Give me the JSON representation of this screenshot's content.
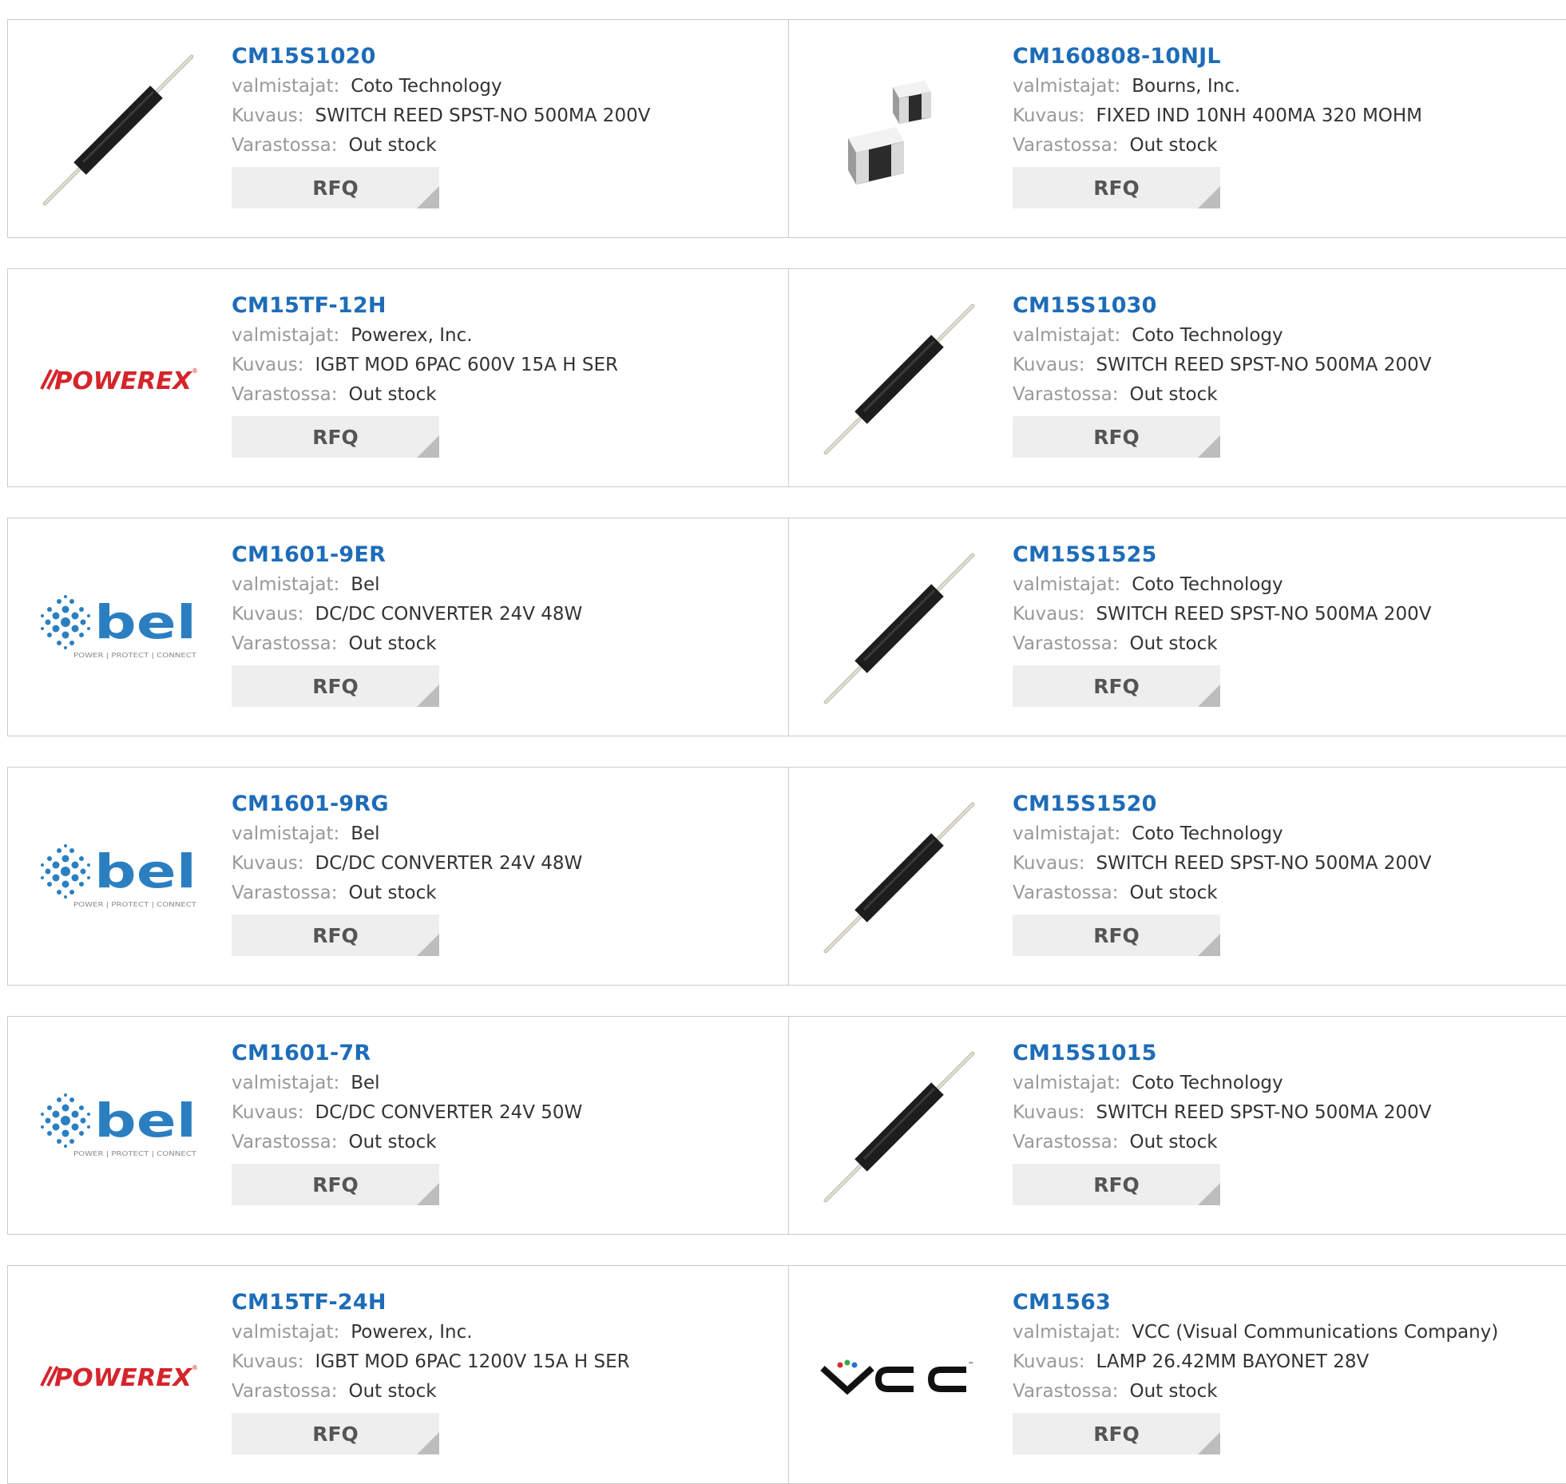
{
  "labels": {
    "manufacturer": "valmistajat:",
    "description": "Kuvaus:",
    "stock": "Varastossa:",
    "rfq": "RFQ"
  },
  "colors": {
    "link": "#1e6cb8",
    "label": "#999999",
    "value": "#333333",
    "border": "#cccccc",
    "button_bg": "#eeeeee"
  },
  "products": [
    {
      "part": "CM15S1020",
      "manufacturer": "Coto Technology",
      "description": "SWITCH REED SPST-NO 500MA 200V",
      "stock": "Out stock",
      "image": "reed-switch-image"
    },
    {
      "part": "CM160808-10NJL",
      "manufacturer": "Bourns, Inc.",
      "description": "FIXED IND 10NH 400MA 320 MOHM",
      "stock": "Out stock",
      "image": "chip-inductor-image"
    },
    {
      "part": "CM15TF-12H",
      "manufacturer": "Powerex, Inc.",
      "description": "IGBT MOD 6PAC 600V 15A H SER",
      "stock": "Out stock",
      "image": "powerex-logo"
    },
    {
      "part": "CM15S1030",
      "manufacturer": "Coto Technology",
      "description": "SWITCH REED SPST-NO 500MA 200V",
      "stock": "Out stock",
      "image": "reed-switch-image"
    },
    {
      "part": "CM1601-9ER",
      "manufacturer": "Bel",
      "description": "DC/DC CONVERTER 24V 48W",
      "stock": "Out stock",
      "image": "bel-logo"
    },
    {
      "part": "CM15S1525",
      "manufacturer": "Coto Technology",
      "description": "SWITCH REED SPST-NO 500MA 200V",
      "stock": "Out stock",
      "image": "reed-switch-image"
    },
    {
      "part": "CM1601-9RG",
      "manufacturer": "Bel",
      "description": "DC/DC CONVERTER 24V 48W",
      "stock": "Out stock",
      "image": "bel-logo"
    },
    {
      "part": "CM15S1520",
      "manufacturer": "Coto Technology",
      "description": "SWITCH REED SPST-NO 500MA 200V",
      "stock": "Out stock",
      "image": "reed-switch-image"
    },
    {
      "part": "CM1601-7R",
      "manufacturer": "Bel",
      "description": "DC/DC CONVERTER 24V 50W",
      "stock": "Out stock",
      "image": "bel-logo"
    },
    {
      "part": "CM15S1015",
      "manufacturer": "Coto Technology",
      "description": "SWITCH REED SPST-NO 500MA 200V",
      "stock": "Out stock",
      "image": "reed-switch-image"
    },
    {
      "part": "CM15TF-24H",
      "manufacturer": "Powerex, Inc.",
      "description": "IGBT MOD 6PAC 1200V 15A H SER",
      "stock": "Out stock",
      "image": "powerex-logo"
    },
    {
      "part": "CM1563",
      "manufacturer": "VCC (Visual Communications Company)",
      "description": "LAMP 26.42MM BAYONET 28V",
      "stock": "Out stock",
      "image": "vcc-logo"
    }
  ],
  "logos": {
    "powerex": "POWEREX",
    "bel": "bel",
    "bel_tagline": "POWER | PROTECT | CONNECT",
    "vcc": "VCC",
    "vcc_tm": "™"
  }
}
